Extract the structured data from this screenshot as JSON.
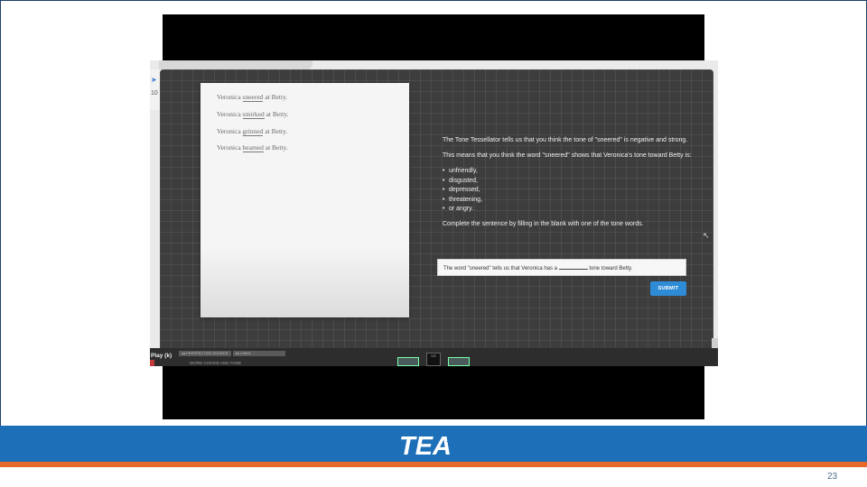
{
  "app": {
    "left_strip_number": "10",
    "passage": [
      {
        "prefix": "Veronica ",
        "verb": "sneered",
        "suffix": " at Betty."
      },
      {
        "prefix": "Veronica ",
        "verb": "smirked",
        "suffix": " at Betty."
      },
      {
        "prefix": "Veronica ",
        "verb": "grinned",
        "suffix": " at Betty."
      },
      {
        "prefix": "Veronica ",
        "verb": "beamed",
        "suffix": " at Betty."
      }
    ],
    "prompt": {
      "p1": "The Tone Tessellator tells us that you think the tone of \"sneered\" is negative and strong.",
      "p2": "This means that you think the word \"sneered\" shows that Veronica's tone toward Betty is:",
      "tones": [
        "unfriendly,",
        "disgusted,",
        "depressed,",
        "threatening,",
        "or angry."
      ],
      "p3": "Complete the sentence by filling in the blank with one of the tone words."
    },
    "answer": {
      "before": "The word \"sneered\" tells us that Veronica has a ",
      "after": " tone toward Betty."
    },
    "submit_label": "SUBMIT",
    "bottom_bar": {
      "play_label": "Play (k)",
      "tab1": "◂◂ PERSPECTIVE SOURCE",
      "tab2": "▸▸ LINKS",
      "title": "WORD CHOICE AND TONE",
      "counter": "0/5"
    }
  },
  "footer": {
    "logo_text": "TEA",
    "page_number": "23"
  },
  "colors": {
    "footer_blue": "#1d6fb8",
    "footer_orange": "#e8682a",
    "submit_blue": "#2e8bd6",
    "grid_bg": "#3d3d3d"
  }
}
